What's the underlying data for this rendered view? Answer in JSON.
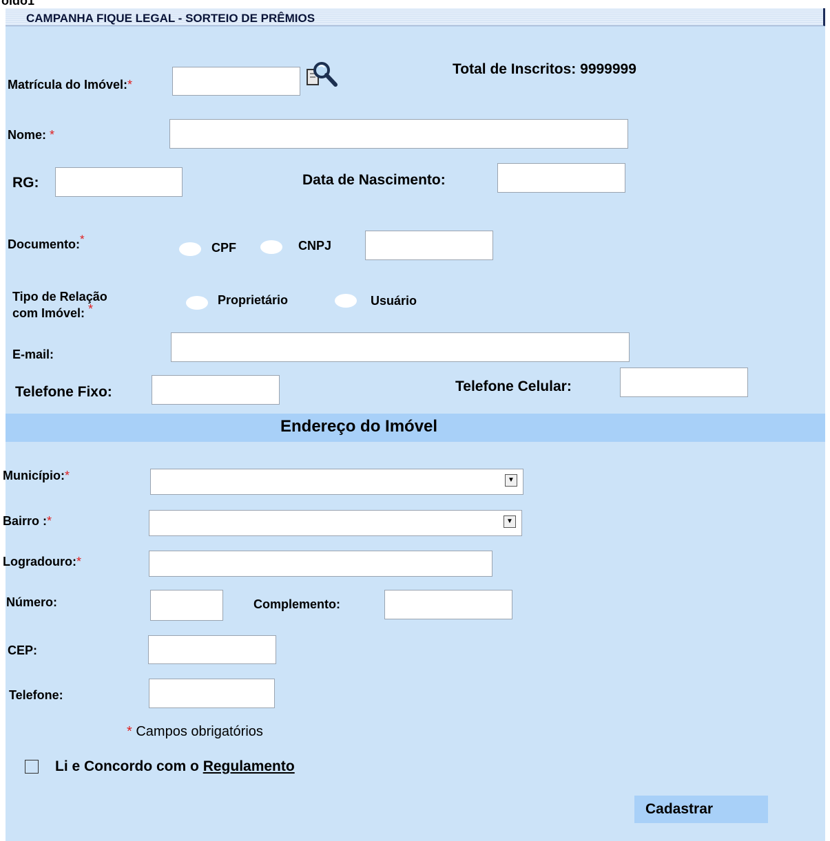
{
  "frame_title": "oldo1",
  "header": {
    "title": "CAMPANHA FIQUE LEGAL - SORTEIO DE PRÊMIOS"
  },
  "required_mark": "*",
  "total_inscritos": "Total de Inscritos: 9999999",
  "fields": {
    "matricula": "Matrícula do Imóvel:",
    "nome": "Nome:",
    "rg": "RG:",
    "data_nascimento": "Data de Nascimento:",
    "documento": "Documento:",
    "doc_cpf": "CPF",
    "doc_cnpj": "CNPJ",
    "tipo_relacao_line1": "Tipo de Relação",
    "tipo_relacao_line2": "com Imóvel:",
    "rel_proprietario": "Proprietário",
    "rel_usuario": "Usuário",
    "email": "E-mail:",
    "telefone_fixo": "Telefone Fixo:",
    "telefone_celular": "Telefone Celular:"
  },
  "address_section": {
    "title": "Endereço do  Imóvel",
    "municipio": "Município:",
    "bairro": "Bairro :",
    "logradouro": "Logradouro:",
    "numero": "Número:",
    "complemento": "Complemento:",
    "cep": "CEP:",
    "telefone": "Telefone:"
  },
  "required_note": "Campos obrigatórios",
  "terms": {
    "prefix": "Li e Concordo com o ",
    "link": "Regulamento"
  },
  "submit_label": "Cadastrar",
  "icons": {
    "search": "search-magnifier-icon",
    "select_arrow": "chevron-down-icon"
  }
}
